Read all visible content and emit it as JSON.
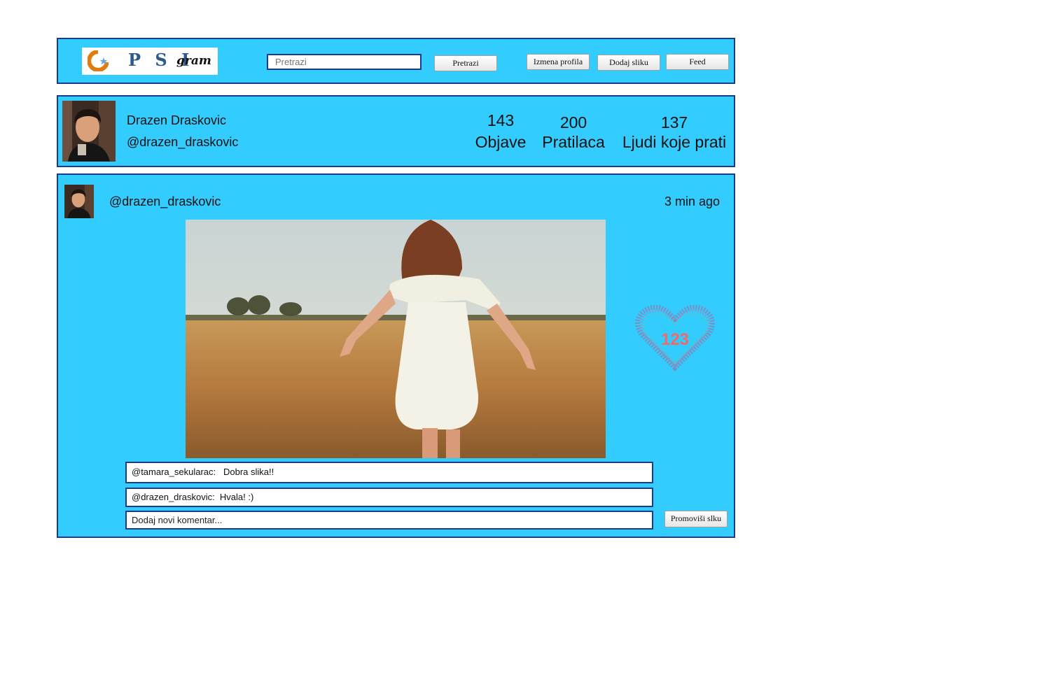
{
  "header": {
    "logo_word": "P S I",
    "logo_gram": "gram",
    "search_placeholder": "Pretrazi",
    "search_button": "Pretrazi",
    "edit_profile_button": "Izmena profila",
    "add_image_button": "Dodaj sliku",
    "feed_button": "Feed"
  },
  "profile": {
    "full_name": "Drazen Draskovic",
    "handle": "@drazen_draskovic",
    "stats": [
      {
        "value": "143",
        "label": "Objave"
      },
      {
        "value": "200",
        "label": "Pratilaca"
      },
      {
        "value": "137",
        "label": "Ljudi koje prati"
      }
    ]
  },
  "post": {
    "handle": "@drazen_draskovic",
    "time": "3 min ago",
    "likes": "123",
    "comments": [
      {
        "text": "@tamara_sekularac:   Dobra slika!!"
      },
      {
        "text": "@drazen_draskovic:  Hvala! :)"
      }
    ],
    "new_comment_placeholder": "Dodaj novi komentar...",
    "promote_button": "Promoviši slku"
  },
  "colors": {
    "panel_bg": "#33ccff",
    "panel_border": "#1a3a8a",
    "likes_text": "#f06a6a"
  }
}
